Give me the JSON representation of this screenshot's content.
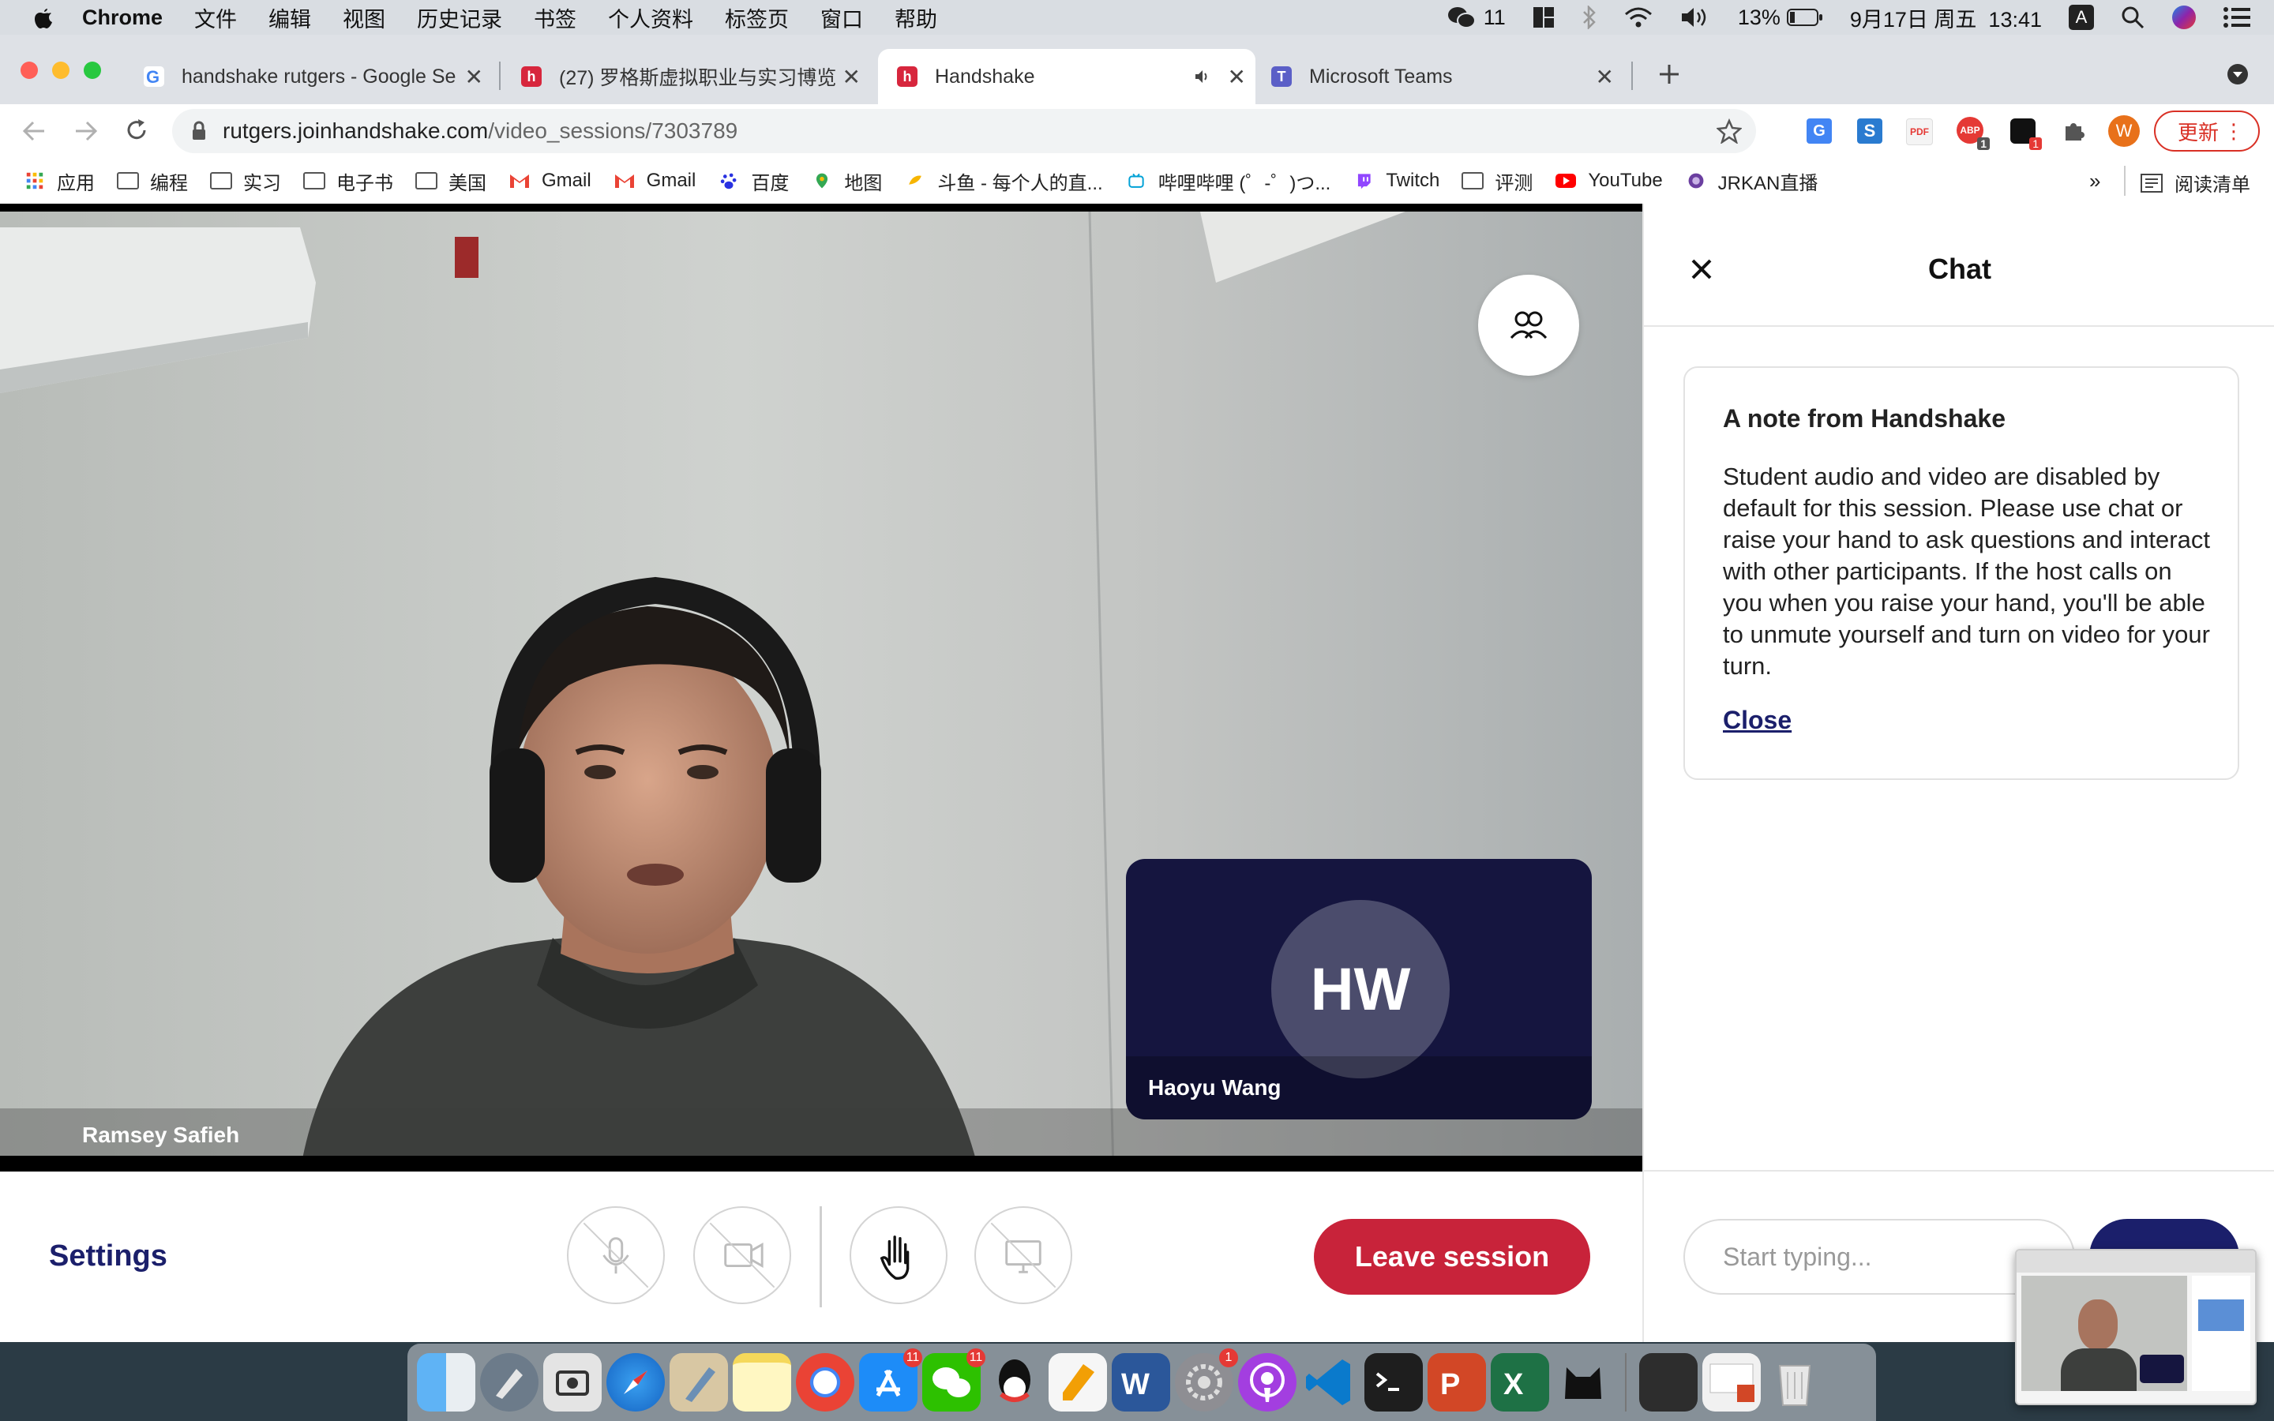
{
  "menubar": {
    "app_name": "Chrome",
    "menus": [
      "文件",
      "编辑",
      "视图",
      "历史记录",
      "书签",
      "个人资料",
      "标签页",
      "窗口",
      "帮助"
    ],
    "wechat_count": "11",
    "battery": "13%",
    "datetime": "9月17日 周五  13:41",
    "input_method": "A"
  },
  "tabs": [
    {
      "title": "handshake rutgers - Google Se",
      "icon": "google-icon"
    },
    {
      "title": "(27) 罗格斯虚拟职业与实习博览",
      "icon": "handshake-icon"
    },
    {
      "title": "Handshake",
      "icon": "handshake-icon"
    },
    {
      "title": "Microsoft Teams",
      "icon": "teams-icon"
    }
  ],
  "address": {
    "domain": "rutgers.joinhandshake.com",
    "path": "/video_sessions/7303789"
  },
  "extensions": {
    "profile_letter": "W",
    "update_label": "更新",
    "badge_a": "1",
    "badge_b": "1"
  },
  "bookmarks": [
    {
      "label": "应用",
      "icon": "apps-grid-icon"
    },
    {
      "label": "编程",
      "icon": "folder-icon"
    },
    {
      "label": "实习",
      "icon": "folder-icon"
    },
    {
      "label": "电子书",
      "icon": "folder-icon"
    },
    {
      "label": "美国",
      "icon": "folder-icon"
    },
    {
      "label": "Gmail",
      "icon": "gmail-icon"
    },
    {
      "label": "Gmail",
      "icon": "gmail-icon"
    },
    {
      "label": "百度",
      "icon": "baidu-icon"
    },
    {
      "label": "地图",
      "icon": "maps-icon"
    },
    {
      "label": "斗鱼 - 每个人的直...",
      "icon": "douyu-icon"
    },
    {
      "label": "哔哩哔哩 (゜-゜)つ...",
      "icon": "bilibili-icon"
    },
    {
      "label": "Twitch",
      "icon": "twitch-icon"
    },
    {
      "label": "评测",
      "icon": "folder-icon"
    },
    {
      "label": "YouTube",
      "icon": "youtube-icon"
    },
    {
      "label": "JRKAN直播",
      "icon": "jrkan-icon"
    }
  ],
  "bookmarks_overflow": "»",
  "reading_list": "阅读清单",
  "video": {
    "host_name": "Ramsey Safieh",
    "self_initials": "HW",
    "self_name": "Haoyu Wang"
  },
  "controls": {
    "settings_label": "Settings",
    "leave_label": "Leave session"
  },
  "chat": {
    "title": "Chat",
    "note_title": "A note from Handshake",
    "note_body": "Student audio and video are disabled by default for this session. Please use chat or raise your hand to ask questions and interact with other participants. If the host calls on you when you raise your hand, you'll be able to unmute yourself and turn on video for your turn.",
    "close_link": "Close",
    "input_placeholder": "Start typing..."
  },
  "dock": {
    "appstore_badge": "11",
    "wechat_badge": "11",
    "prefs_badge": "1"
  },
  "colors": {
    "brand_navy": "#1b1f6b",
    "leave_red": "#c8233a",
    "tile_navy": "#15153f"
  }
}
